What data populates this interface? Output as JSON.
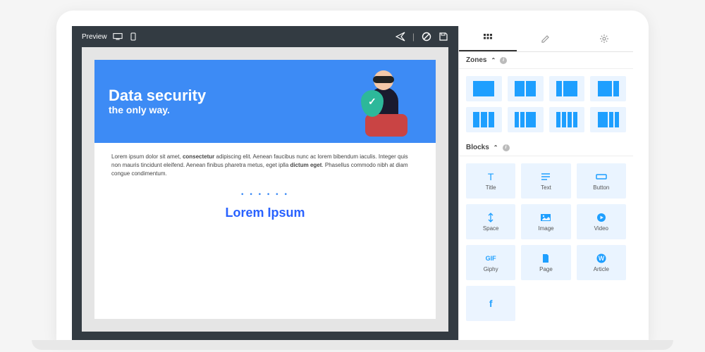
{
  "toolbar": {
    "preview_label": "Preview"
  },
  "hero": {
    "title": "Data security",
    "subtitle": "the only way."
  },
  "body": {
    "text_before_bold1": "Lorem ipsum dolor sit amet, ",
    "bold1": "consectetur",
    "text_mid": " adipiscing elit. Aenean faucibus nunc ac lorem bibendum iaculis. Integer quis non mauris tincidunt eleifend. Aenean finibus pharetra metus, eget iplla ",
    "bold2": "dictum eget",
    "text_after": ". Phasellus commodo nibh at diam congue condimentum.",
    "dots": "• • • • • •",
    "cta": "Lorem Ipsum"
  },
  "sidebar": {
    "sections": {
      "zones": "Zones",
      "blocks": "Blocks"
    },
    "blocks": {
      "title": "Title",
      "text": "Text",
      "button": "Button",
      "space": "Space",
      "image": "Image",
      "video": "Video",
      "giphy": "Giphy",
      "page": "Page",
      "article": "Article"
    }
  },
  "colors": {
    "accent": "#1e9fff",
    "hero_bg": "#3d8bf5",
    "toolbar_bg": "#333b42"
  }
}
